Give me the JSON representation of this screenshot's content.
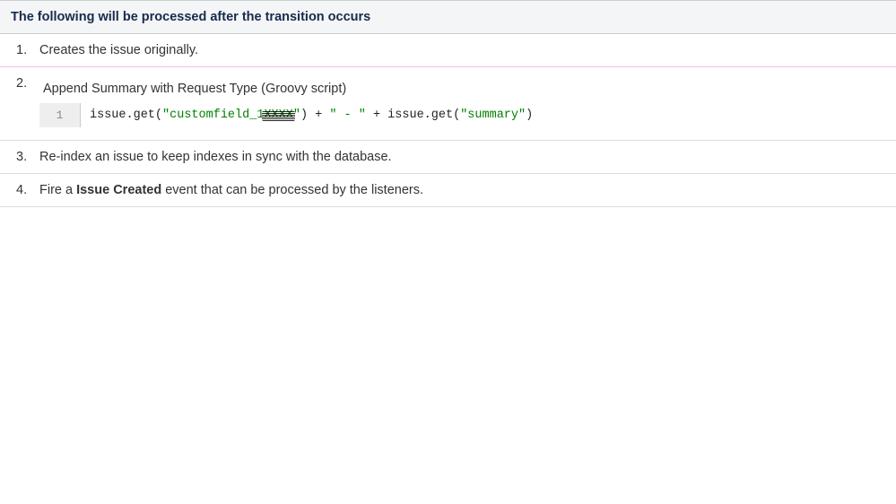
{
  "header": "The following will be processed after the transition occurs",
  "steps": {
    "s1": "Creates the issue originally.",
    "s2_desc": "Append Summary with Request Type (Groovy script)",
    "s3": "Re-index an issue to keep indexes in sync with the database.",
    "s4_pre": "Fire a ",
    "s4_bold": "Issue Created",
    "s4_post": " event that can be processed by the listeners."
  },
  "code": {
    "lineno": "1",
    "t1": "issue.get(",
    "str1": "\"customfield_1",
    "red1": "XXXX",
    "str1b": "\"",
    "t2": ") + ",
    "str2": "\" - \"",
    "t3": " + issue.get(",
    "str3": "\"summary\"",
    "t4": ")"
  }
}
